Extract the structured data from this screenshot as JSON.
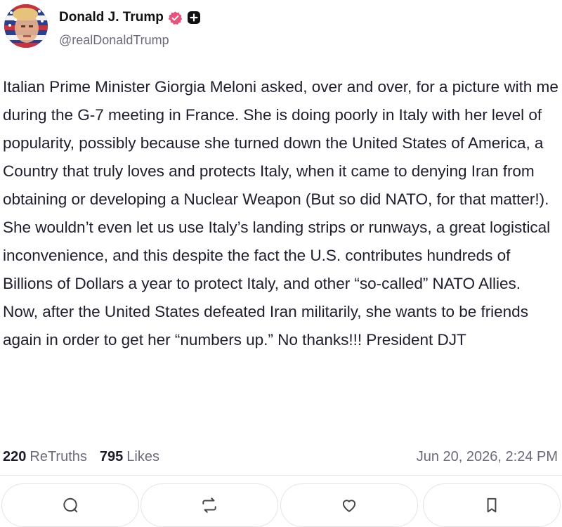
{
  "author": {
    "name": "Donald J. Trump",
    "handle": "@realDonaldTrump"
  },
  "post": {
    "text": "Italian Prime Minister Giorgia Meloni asked, over and over, for a picture with me during the G-7 meeting in France. She is doing poorly in Italy with her level of popularity, possibly because she turned down the United States of America, a Country that truly loves and protects Italy, when it came to denying Iran from obtaining or developing a Nuclear Weapon (But so did NATO, for that matter!). She wouldn’t even let us use Italy’s landing strips or runways, a great logistical inconvenience, and this despite the fact the U.S. contributes hundreds of Billions of Dollars a year to protect Italy, and other “so-called” NATO Allies. Now, after the United States defeated Iran militarily, she wants to be friends again in order to get her “numbers up.” No thanks!!! President DJT"
  },
  "stats": {
    "retruths_count": "220",
    "retruths_label": "ReTruths",
    "likes_count": "795",
    "likes_label": "Likes",
    "timestamp": "Jun 20, 2026, 2:24 PM"
  },
  "actions": [
    {
      "icon": "comment-icon"
    },
    {
      "icon": "retruth-icon"
    },
    {
      "icon": "heart-icon"
    },
    {
      "icon": "bookmark-icon"
    }
  ],
  "colors": {
    "verified_badge": "#e8537b",
    "text": "#1e1e2e",
    "muted": "#6b6b7b"
  }
}
